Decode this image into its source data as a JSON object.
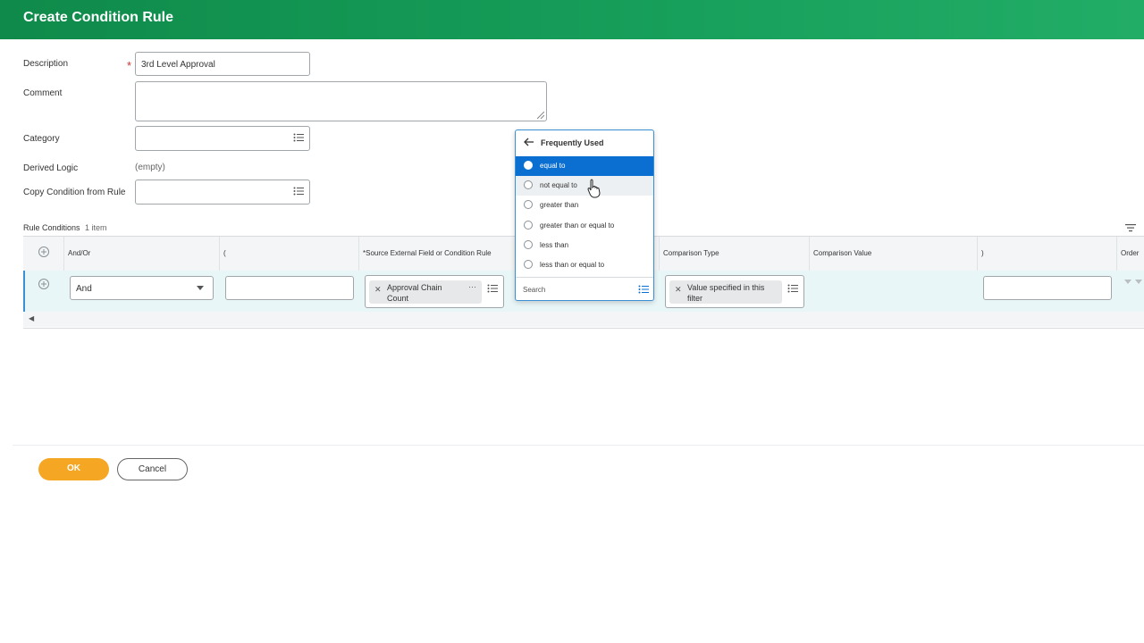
{
  "header": {
    "title": "Create Condition Rule"
  },
  "form": {
    "description_label": "Description",
    "description_value": "3rd Level Approval",
    "comment_label": "Comment",
    "category_label": "Category",
    "derived_logic_label": "Derived Logic",
    "derived_logic_value": "(empty)",
    "copy_label": "Copy Condition from Rule"
  },
  "rule_conditions": {
    "title": "Rule Conditions",
    "count": "1 item",
    "columns": {
      "and_or": "And/Or",
      "open_paren": "(",
      "source": "*Source External Field or Condition Rule",
      "comparison_type": "Comparison Type",
      "comparison_value": "Comparison Value",
      "close_paren": ")",
      "order": "Order"
    },
    "row": {
      "and_or_value": "And",
      "source_value": "Approval Chain Count",
      "comparison_type_value": "Value specified in this filter"
    }
  },
  "dropdown": {
    "title": "Frequently Used",
    "options": [
      "equal to",
      "not equal to",
      "greater than",
      "greater than or equal to",
      "less than",
      "less than or equal to"
    ],
    "search_placeholder": "Search"
  },
  "buttons": {
    "ok": "OK",
    "cancel": "Cancel"
  }
}
